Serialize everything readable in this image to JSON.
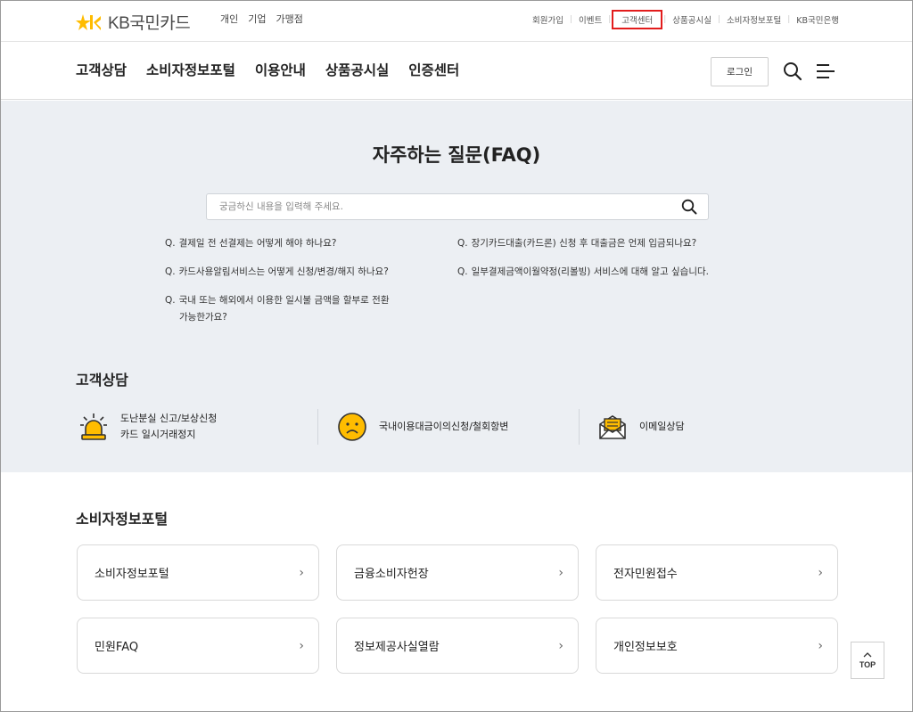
{
  "header": {
    "logo_text": "KB국민카드",
    "biz_tabs": [
      "개인",
      "기업",
      "가맹점"
    ],
    "util_links": [
      "회원가입",
      "이벤트",
      "고객센터",
      "상품공시실",
      "소비자정보포털",
      "KB국민은행"
    ],
    "highlighted_link": "고객센터"
  },
  "gnb": {
    "menu": [
      "고객상담",
      "소비자정보포털",
      "이용안내",
      "상품공시실",
      "인증센터"
    ],
    "login_label": "로그인",
    "search_icon": "search-icon",
    "menu_icon": "hamburger-icon"
  },
  "faq": {
    "title": "자주하는 질문(FAQ)",
    "search_placeholder": "궁금하신 내용을 입력해 주세요.",
    "questions": [
      "결제일 전 선결제는 어떻게 해야 하나요?",
      "장기카드대출(카드론) 신청 후 대출금은 언제 입금되나요?",
      "카드사용알림서비스는 어떻게 신청/변경/해지 하나요?",
      "일부결제금액이월약정(리볼빙) 서비스에 대해 알고 싶습니다.",
      "국내 또는 해외에서 이용한 일시불 금액을 할부로 전환",
      "가능한가요?"
    ],
    "q_prefix": "Q."
  },
  "consult": {
    "title": "고객상담",
    "items": [
      {
        "line1": "도난분실 신고/보상신청",
        "line2": "카드 일시거래정지",
        "icon": "siren-icon"
      },
      {
        "line1": "국내이용대금이의신청/철회항변",
        "icon": "sad-face-icon"
      },
      {
        "line1": "이메일상담",
        "icon": "email-icon"
      }
    ]
  },
  "portal": {
    "title": "소비자정보포털",
    "cards": [
      "소비자정보포털",
      "금융소비자헌장",
      "전자민원접수",
      "민원FAQ",
      "정보제공사실열람",
      "개인정보보호"
    ],
    "chevron": "›"
  },
  "top_button": {
    "label": "TOP"
  },
  "colors": {
    "brand_yellow": "#ffbc00",
    "highlight_red": "#e21c1c",
    "section_bg": "#eceff3"
  }
}
